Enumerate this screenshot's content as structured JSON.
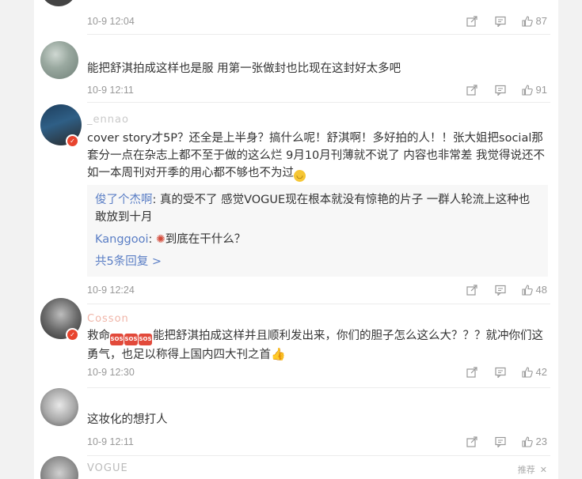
{
  "comments": [
    {
      "username": "",
      "text": "",
      "time": "10-9 12:04",
      "likes": "87"
    },
    {
      "username": "",
      "text": "能把舒淇拍成这样也是服 用第一张做封也比现在这封好太多吧",
      "time": "10-9 12:11",
      "likes": "91"
    },
    {
      "username": "_ennao",
      "text": "cover story才5P？还全是上半身？搞什么呢！舒淇啊！多好拍的人！！张大姐把social那套分一点在杂志上都不至于做的这么烂 9月10月刊薄就不说了 内容也非常差 我觉得说还不如一本周刊对开季的用心都不够也不为过",
      "time": "10-9 12:24",
      "likes": "48",
      "replies": [
        {
          "name": "俊了个杰啊",
          "text": ": 真的受不了 感觉VOGUE现在根本就没有惊艳的片子 一群人轮流上这种也敢放到十月"
        },
        {
          "name": "Kanggooi",
          "text": "到底在干什么？"
        }
      ],
      "more_replies": "共5条回复 >"
    },
    {
      "username": "Cosson",
      "text_prefix": "救命",
      "emoji_sos": [
        "SOS",
        "SOS",
        "SOS"
      ],
      "text": "能把舒淇拍成这样并且顺利发出来，你们的胆子怎么这么大？？？就冲你们这勇气，也足以称得上国内四大刊之首",
      "time": "10-9 12:30",
      "likes": "42"
    },
    {
      "username": "",
      "text": "这妆化的想打人",
      "time": "10-9 12:11",
      "likes": "23"
    }
  ],
  "last_username": "VOGUE",
  "footer": {
    "label": "推荐",
    "close": "✕"
  },
  "icons": {
    "share": "share-icon",
    "comment": "comment-icon",
    "like": "thumbs-up-icon"
  },
  "colors": {
    "link": "#5a7ec5",
    "meta": "#999999",
    "badge": "#e8442e"
  }
}
